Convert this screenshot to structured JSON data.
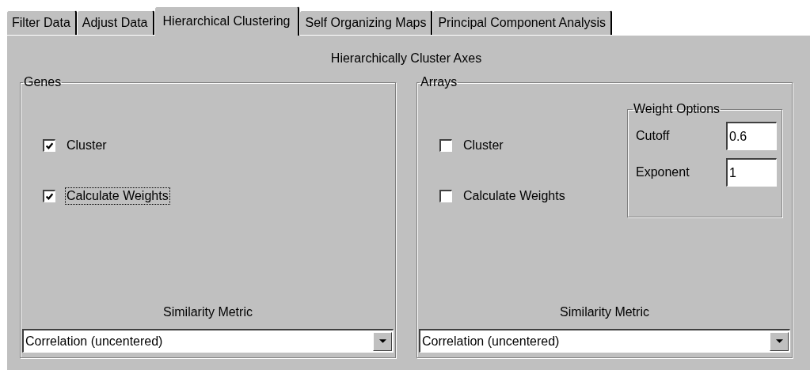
{
  "tabs": [
    {
      "label": "Filter Data",
      "selected": false
    },
    {
      "label": "Adjust Data",
      "selected": false
    },
    {
      "label": "Hierarchical Clustering",
      "selected": true
    },
    {
      "label": "Self Organizing Maps",
      "selected": false
    },
    {
      "label": "Principal Component Analysis",
      "selected": false
    }
  ],
  "heading": "Hierarchically Cluster Axes",
  "groups": [
    {
      "title": "Genes",
      "checkboxes": [
        {
          "label": "Cluster",
          "checked": true,
          "focused": false
        },
        {
          "label": "Calculate Weights",
          "checked": true,
          "focused": true
        }
      ],
      "metric_label": "Similarity Metric",
      "metric_value": "Correlation (uncentered)"
    },
    {
      "title": "Arrays",
      "checkboxes": [
        {
          "label": "Cluster",
          "checked": false,
          "focused": false
        },
        {
          "label": "Calculate Weights",
          "checked": false,
          "focused": false
        }
      ],
      "weight_options": {
        "title": "Weight Options",
        "fields": [
          {
            "label": "Cutoff",
            "value": "0.6"
          },
          {
            "label": "Exponent",
            "value": "1"
          }
        ]
      },
      "metric_label": "Similarity Metric",
      "metric_value": "Correlation (uncentered)"
    }
  ]
}
